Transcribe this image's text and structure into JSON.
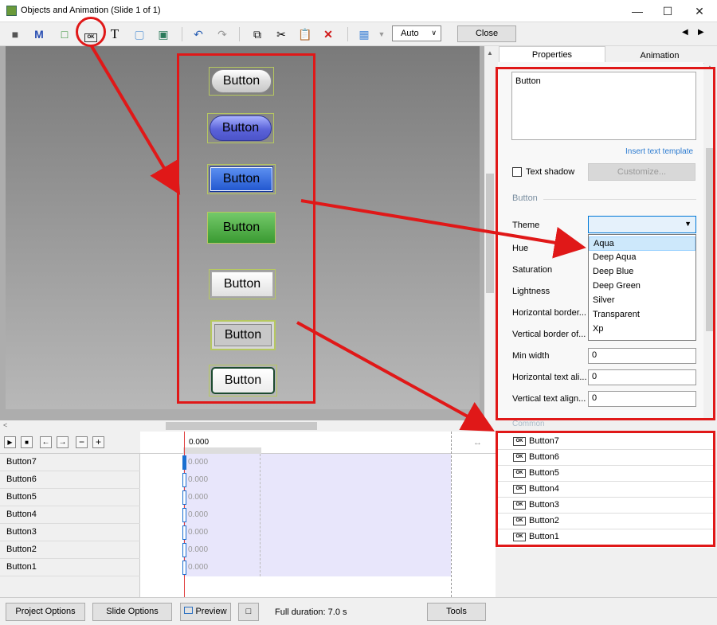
{
  "window": {
    "title": "Objects and Animation (Slide 1 of 1)"
  },
  "toolbar": {
    "zoom": "Auto",
    "close": "Close"
  },
  "tabs": {
    "properties": "Properties",
    "animation": "Animation"
  },
  "canvas_buttons": [
    {
      "label": "Button",
      "theme": "Aqua"
    },
    {
      "label": "Button",
      "theme": "Deep Aqua"
    },
    {
      "label": "Button",
      "theme": "Deep Blue"
    },
    {
      "label": "Button",
      "theme": "Deep Green"
    },
    {
      "label": "Button",
      "theme": "Silver"
    },
    {
      "label": "Button",
      "theme": "Transparent"
    },
    {
      "label": "Button",
      "theme": "Xp"
    }
  ],
  "properties": {
    "text_value": "Button",
    "insert_template": "Insert text template",
    "text_shadow": "Text shadow",
    "customize": "Customize...",
    "section_button": "Button",
    "theme": "Theme",
    "hue": "Hue",
    "saturation": "Saturation",
    "lightness": "Lightness",
    "horiz_border": "Horizontal border...",
    "vert_border": "Vertical border of...",
    "min_width": "Min width",
    "min_width_val": "0",
    "horiz_text": "Horizontal text ali...",
    "horiz_text_val": "0",
    "vert_text": "Vertical text align...",
    "vert_text_val": "0",
    "common": "Common"
  },
  "theme_options": [
    "Aqua",
    "Deep Aqua",
    "Deep Blue",
    "Deep Green",
    "Silver",
    "Transparent",
    "Xp"
  ],
  "objects": [
    "Button7",
    "Button6",
    "Button5",
    "Button4",
    "Button3",
    "Button2",
    "Button1"
  ],
  "timeline": {
    "time": "0.000",
    "values": [
      "0.000",
      "0.000",
      "0.000",
      "0.000",
      "0.000",
      "0.000",
      "0.000"
    ]
  },
  "status": {
    "project_options": "Project Options",
    "slide_options": "Slide Options",
    "preview": "Preview",
    "duration": "Full duration: 7.0 s",
    "tools": "Tools"
  }
}
